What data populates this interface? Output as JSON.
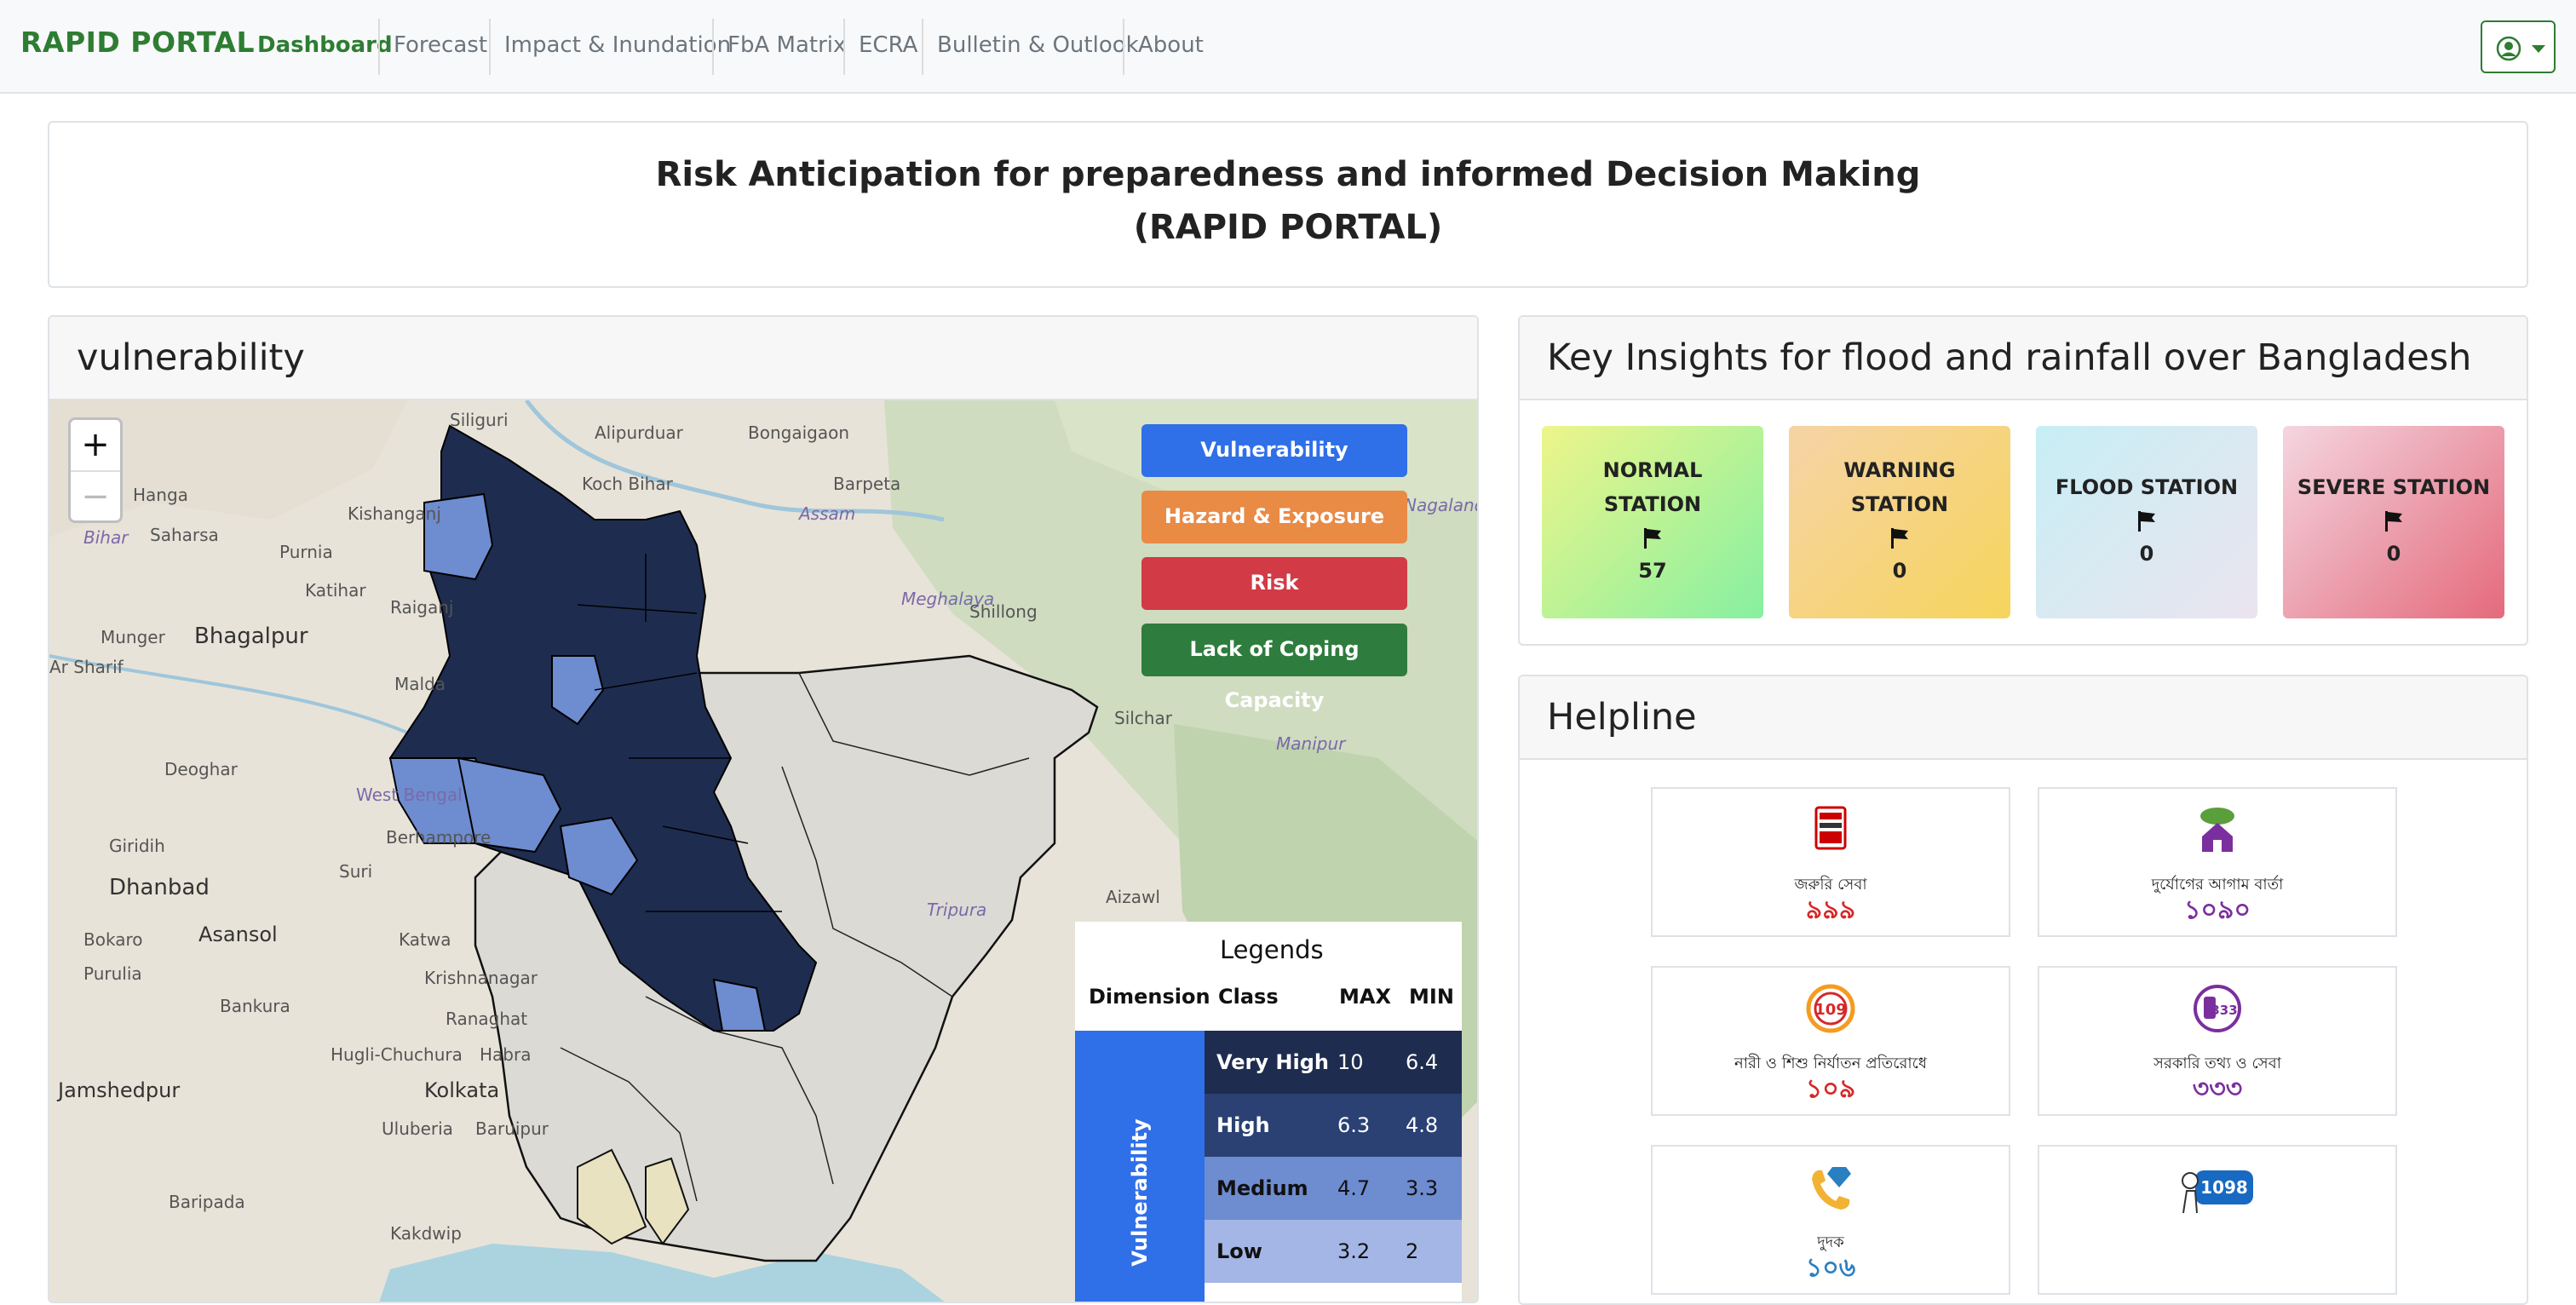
{
  "nav": {
    "brand": "RAPID PORTAL",
    "items": [
      {
        "label": "Dashboard",
        "active": true
      },
      {
        "label": "Forecast",
        "active": false
      },
      {
        "label": "Impact & Inundation",
        "active": false
      },
      {
        "label": "FbA Matrix",
        "active": false
      },
      {
        "label": "ECRA",
        "active": false
      },
      {
        "label": "Bulletin & Outlook",
        "active": false
      },
      {
        "label": "About",
        "active": false
      }
    ],
    "user_icon": "user-circle-icon"
  },
  "title": {
    "line1": "Risk Anticipation for preparedness and informed Decision Making",
    "line2": "(RAPID PORTAL)"
  },
  "map_card": {
    "header": "vulnerability",
    "zoom_in": "+",
    "zoom_out": "−",
    "layer_buttons": [
      {
        "label": "Vulnerability",
        "color": "#2f6fe8"
      },
      {
        "label": "Hazard & Exposure",
        "color": "#e98a45"
      },
      {
        "label": "Risk",
        "color": "#d23a45"
      },
      {
        "label": "Lack of Coping Capacity",
        "color": "#2e7d3e"
      }
    ],
    "place_labels": [
      "Siliguri",
      "Alipurduar",
      "Bongaigaon",
      "Kishanganj",
      "Koch Bihar",
      "Barpeta",
      "Purnia",
      "Assam",
      "Saharsa",
      "Katihar",
      "Raiganj",
      "Meghalaya",
      "Shillong",
      "Munger",
      "Bhagalpur",
      "Malda",
      "Silchar",
      "Deoghar",
      "Manipur",
      "West Bengal",
      "Giridih",
      "Berhampore",
      "Suri",
      "Aizawl",
      "Dhanbad",
      "Bokaro",
      "Asansol",
      "Katwa",
      "Tripura",
      "Purulia",
      "Bankura",
      "Krishnanagar",
      "Ranaghat",
      "Hugli-Chuchura",
      "Habra",
      "Jamshedpur",
      "Kolkata",
      "Uluberia",
      "Baruipur",
      "Baripada",
      "Kakdwip",
      "Bihar",
      "Hanga",
      "Nagaland",
      "Ar Sharif"
    ],
    "legend": {
      "title": "Legends",
      "headers": [
        "Dimension",
        "Class",
        "MAX",
        "MIN"
      ],
      "dimension": "Vulnerability",
      "rows": [
        {
          "class": "Very High",
          "max": "10",
          "min": "6.4",
          "color": "#1e2c4f"
        },
        {
          "class": "High",
          "max": "6.3",
          "min": "4.8",
          "color": "#2b4174"
        },
        {
          "class": "Medium",
          "max": "4.7",
          "min": "3.3",
          "color": "#6e8cd0"
        },
        {
          "class": "Low",
          "max": "3.2",
          "min": "2",
          "color": "#a4b6e5"
        }
      ]
    }
  },
  "insights": {
    "header": "Key Insights for flood and rainfall over Bangladesh",
    "stations": [
      {
        "line1": "NORMAL",
        "line2": "STATION",
        "count": "57",
        "bg": "linear-gradient(135deg,#eef58a,#86f0a1)"
      },
      {
        "line1": "WARNING",
        "line2": "STATION",
        "count": "0",
        "bg": "linear-gradient(135deg,#f6d3a6,#f6d55c)"
      },
      {
        "line1": "FLOOD STATION",
        "line2": "",
        "count": "0",
        "bg": "linear-gradient(135deg,#c7eef5,#ebe4ef)"
      },
      {
        "line1": "SEVERE STATION",
        "line2": "",
        "count": "0",
        "bg": "linear-gradient(135deg,#f4d6e0,#e46a7c)"
      }
    ]
  },
  "helpline": {
    "header": "Helpline",
    "items": [
      {
        "icon": "help-desk-999-icon",
        "line1": "জরুরি সেবা",
        "number": "৯৯৯",
        "color": "#d62828"
      },
      {
        "icon": "disaster-house-icon",
        "line1": "দুর্যোগের আগাম বার্তা",
        "number": "১০৯০",
        "color": "#7b2f9e"
      },
      {
        "icon": "women-child-109-icon",
        "line1": "নারী ও শিশু নির্যাতন প্রতিরোধে",
        "number": "১০৯",
        "color": "#d62828"
      },
      {
        "icon": "govt-info-333-icon",
        "line1": "সরকারি তথ্য ও সেবা",
        "number": "৩৩৩",
        "color": "#7b2f9e"
      },
      {
        "icon": "anti-corruption-106-icon",
        "line1": "দুদক",
        "number": "১০৬",
        "color": "#2a7fc1"
      },
      {
        "icon": "child-helpline-1098-icon",
        "line1": "",
        "number": "1098",
        "color": "#1769c2"
      }
    ]
  }
}
